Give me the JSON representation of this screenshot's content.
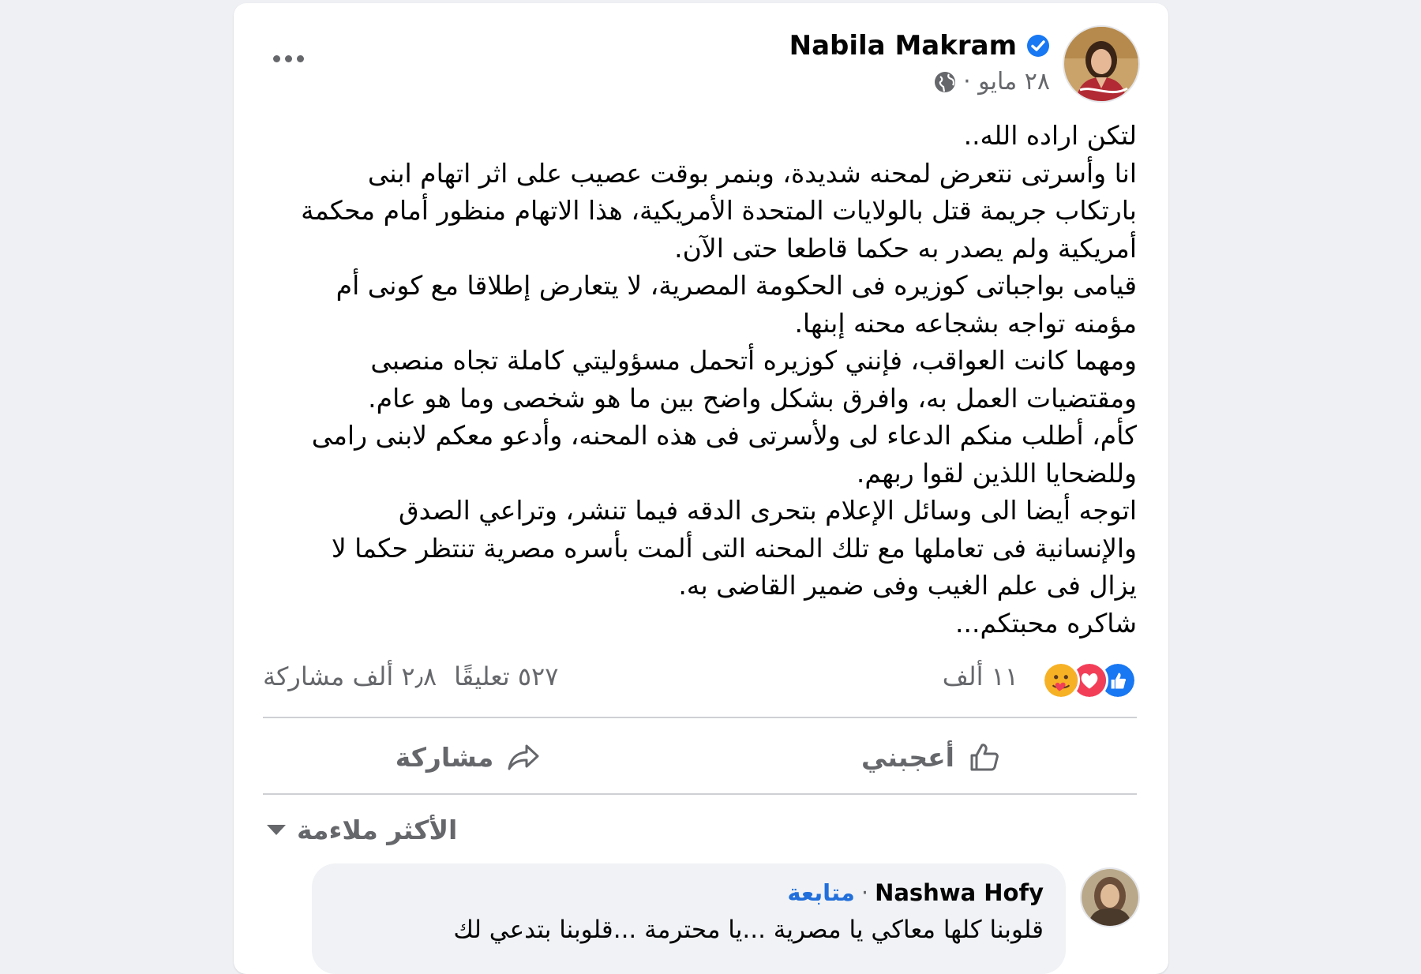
{
  "post": {
    "author": "Nabila Makram",
    "date": "٢٨ مايو ·",
    "body_lines": [
      "لتكن اراده الله..",
      "انا وأسرتى نتعرض لمحنه شديدة، وبنمر بوقت عصيب على اثر اتهام ابنى",
      "بارتكاب جريمة قتل بالولايات المتحدة الأمريكية، هذا الاتهام منظور أمام محكمة",
      "أمريكية ولم يصدر به حكما قاطعا حتى الآن.",
      "قيامى بواجباتى كوزيره فى الحكومة المصرية، لا يتعارض إطلاقا مع كونى أم",
      "مؤمنه تواجه بشجاعه محنه إبنها.",
      "ومهما كانت العواقب، فإنني كوزيره أتحمل مسؤوليتي كاملة تجاه منصبى",
      "ومقتضيات العمل به، وافرق بشكل واضح بين ما هو شخصى وما هو عام.",
      "كأم، أطلب منكم الدعاء لى ولأسرتى فى هذه المحنه، وأدعو معكم لابنى رامى",
      "وللضحايا اللذين لقوا ربهم.",
      "اتوجه أيضا الى وسائل الإعلام بتحرى الدقه فيما تنشر، وتراعي الصدق",
      "والإنسانية فى تعاملها مع تلك المحنه التى ألمت بأسره مصرية تنتظر حكما لا",
      "يزال فى علم الغيب وفى ضمير القاضى به.",
      "شاكره محبتكم..."
    ]
  },
  "stats": {
    "reactions_count": "١١ ألف",
    "comments": "٥٢٧ تعليقًا",
    "shares": "٢٫٨ ألف مشاركة"
  },
  "actions": {
    "like_label": "أعجبني",
    "share_label": "مشاركة"
  },
  "comments_sort": "الأكثر ملاءمة",
  "comment": {
    "author": "Nashwa Hofy",
    "follow": "متابعة",
    "text": "قلوبنا كلها معاكي يا مصرية ...يا محترمة ...قلوبنا بتدعي لك"
  },
  "colors": {
    "like_blue": "#1877f2",
    "love_red": "#f33e58",
    "care_yellow": "#f7b125",
    "link_blue": "#216fdb",
    "secondary_text": "#65676b"
  },
  "icons": [
    "more-icon",
    "verified-icon",
    "globe-icon",
    "like-reaction-icon",
    "love-reaction-icon",
    "care-reaction-icon",
    "thumbs-up-icon",
    "share-arrow-icon",
    "caret-down-icon"
  ]
}
